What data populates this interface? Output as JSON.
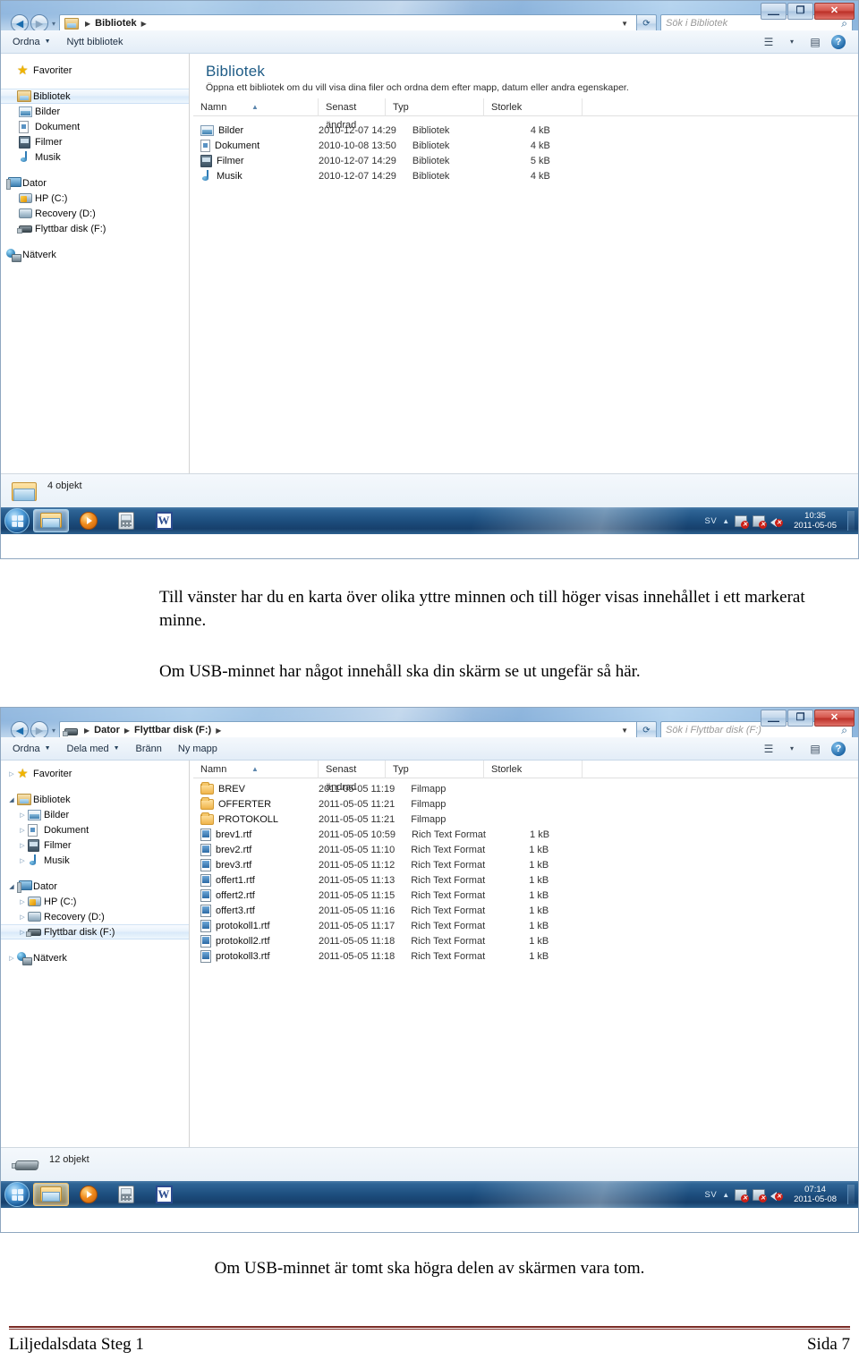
{
  "window1": {
    "titlebar": {
      "minimize_label": "—",
      "maximize_label": "❐",
      "close_label": "✕"
    },
    "address": {
      "crumb": "Bibliotek",
      "separator": "▶",
      "dropdown": "▼",
      "refresh": "⟳",
      "folder_icon": "library-folder-icon"
    },
    "search": {
      "placeholder": "Sök i Bibliotek",
      "icon": "search-icon"
    },
    "commandbar": {
      "items": [
        {
          "label": "Ordna",
          "has_caret": true
        },
        {
          "label": "Nytt bibliotek",
          "has_caret": false
        }
      ],
      "view_icon": "view-list-icon",
      "view_caret": "▾",
      "preview_icon": "preview-pane-icon",
      "help_icon": "help-icon",
      "help_label": "?"
    },
    "navpane": {
      "groups": [
        {
          "items": [
            {
              "label": "Favoriter",
              "icon": "star-icon",
              "indent": 0,
              "arrow": "",
              "selected": false
            }
          ]
        },
        {
          "items": [
            {
              "label": "Bibliotek",
              "icon": "library-folder-icon",
              "indent": 0,
              "arrow": "",
              "selected": true
            },
            {
              "label": "Bilder",
              "icon": "pictures-icon",
              "indent": 1,
              "arrow": "",
              "selected": false
            },
            {
              "label": "Dokument",
              "icon": "documents-icon",
              "indent": 1,
              "arrow": "",
              "selected": false
            },
            {
              "label": "Filmer",
              "icon": "videos-icon",
              "indent": 1,
              "arrow": "",
              "selected": false
            },
            {
              "label": "Musik",
              "icon": "music-icon",
              "indent": 1,
              "arrow": "",
              "selected": false
            }
          ]
        },
        {
          "items": [
            {
              "label": "Dator",
              "icon": "computer-icon",
              "indent": 0,
              "arrow": "",
              "selected": false
            },
            {
              "label": "HP (C:)",
              "icon": "system-drive-icon",
              "indent": 1,
              "arrow": "",
              "selected": false
            },
            {
              "label": "Recovery (D:)",
              "icon": "drive-icon",
              "indent": 1,
              "arrow": "",
              "selected": false
            },
            {
              "label": "Flyttbar disk (F:)",
              "icon": "usb-drive-icon",
              "indent": 1,
              "arrow": "",
              "selected": false
            }
          ]
        },
        {
          "items": [
            {
              "label": "Nätverk",
              "icon": "network-icon",
              "indent": 0,
              "arrow": "",
              "selected": false
            }
          ]
        }
      ]
    },
    "content": {
      "heading": "Bibliotek",
      "subheading": "Öppna ett bibliotek om du vill visa dina filer och ordna dem efter mapp, datum eller andra egenskaper.",
      "columns": [
        "Namn",
        "Senast ändrad",
        "Typ",
        "Storlek"
      ],
      "sort_indicator": "▲",
      "rows": [
        {
          "name": "Bilder",
          "icon": "pictures-icon",
          "modified": "2010-12-07 14:29",
          "type": "Bibliotek",
          "size": "4 kB"
        },
        {
          "name": "Dokument",
          "icon": "documents-icon",
          "modified": "2010-10-08 13:50",
          "type": "Bibliotek",
          "size": "4 kB"
        },
        {
          "name": "Filmer",
          "icon": "videos-icon",
          "modified": "2010-12-07 14:29",
          "type": "Bibliotek",
          "size": "5 kB"
        },
        {
          "name": "Musik",
          "icon": "music-icon",
          "modified": "2010-12-07 14:29",
          "type": "Bibliotek",
          "size": "4 kB"
        }
      ]
    },
    "details": {
      "icon": "folder-icon",
      "text": "4 objekt"
    },
    "taskbar": {
      "start_icon": "windows-start-orb",
      "buttons": [
        {
          "icon": "explorer-icon",
          "state": "active"
        },
        {
          "icon": "media-player-icon",
          "state": "normal"
        },
        {
          "icon": "calculator-icon",
          "state": "normal"
        },
        {
          "icon": "word-icon",
          "state": "normal"
        }
      ],
      "language": "SV",
      "tray_expand": "▲",
      "tray_icons": [
        "network-error-icon",
        "action-center-icon",
        "volume-muted-icon"
      ],
      "time": "10:35",
      "date": "2011-05-05"
    }
  },
  "text1": {
    "paragraph1": "Till vänster har du en karta över olika yttre minnen och till höger visas innehållet i ett markerat minne.",
    "paragraph2": "Om USB-minnet har något innehåll ska din skärm se ut ungefär så här."
  },
  "window2": {
    "titlebar": {
      "minimize_label": "—",
      "maximize_label": "❐",
      "close_label": "✕"
    },
    "address": {
      "crumb1": "Dator",
      "crumb2": "Flyttbar disk (F:)",
      "separator": "▶",
      "dropdown": "▼",
      "refresh": "⟳",
      "folder_icon": "usb-drive-icon"
    },
    "search": {
      "placeholder": "Sök i Flyttbar disk (F:)",
      "icon": "search-icon"
    },
    "commandbar": {
      "items": [
        {
          "label": "Ordna",
          "has_caret": true
        },
        {
          "label": "Dela med",
          "has_caret": true
        },
        {
          "label": "Bränn",
          "has_caret": false
        },
        {
          "label": "Ny mapp",
          "has_caret": false
        }
      ],
      "view_icon": "view-list-icon",
      "view_caret": "▾",
      "preview_icon": "preview-pane-icon",
      "help_icon": "help-icon",
      "help_label": "?"
    },
    "navpane": {
      "groups": [
        {
          "items": [
            {
              "label": "Favoriter",
              "icon": "star-icon",
              "indent": 0,
              "arrow": "closed",
              "selected": false
            }
          ]
        },
        {
          "items": [
            {
              "label": "Bibliotek",
              "icon": "library-folder-icon",
              "indent": 0,
              "arrow": "open",
              "selected": false
            },
            {
              "label": "Bilder",
              "icon": "pictures-icon",
              "indent": 1,
              "arrow": "closed",
              "selected": false
            },
            {
              "label": "Dokument",
              "icon": "documents-icon",
              "indent": 1,
              "arrow": "closed",
              "selected": false
            },
            {
              "label": "Filmer",
              "icon": "videos-icon",
              "indent": 1,
              "arrow": "closed",
              "selected": false
            },
            {
              "label": "Musik",
              "icon": "music-icon",
              "indent": 1,
              "arrow": "closed",
              "selected": false
            }
          ]
        },
        {
          "items": [
            {
              "label": "Dator",
              "icon": "computer-icon",
              "indent": 0,
              "arrow": "open",
              "selected": false
            },
            {
              "label": "HP (C:)",
              "icon": "system-drive-icon",
              "indent": 1,
              "arrow": "closed",
              "selected": false
            },
            {
              "label": "Recovery (D:)",
              "icon": "drive-icon",
              "indent": 1,
              "arrow": "closed",
              "selected": false
            },
            {
              "label": "Flyttbar disk (F:)",
              "icon": "usb-drive-icon",
              "indent": 1,
              "arrow": "closed",
              "selected": true
            }
          ]
        },
        {
          "items": [
            {
              "label": "Nätverk",
              "icon": "network-icon",
              "indent": 0,
              "arrow": "closed",
              "selected": false
            }
          ]
        }
      ]
    },
    "content": {
      "columns": [
        "Namn",
        "Senast ändrad",
        "Typ",
        "Storlek"
      ],
      "sort_indicator": "▲",
      "rows": [
        {
          "name": "BREV",
          "icon": "folder-icon",
          "modified": "2011-05-05 11:19",
          "type": "Filmapp",
          "size": ""
        },
        {
          "name": "OFFERTER",
          "icon": "folder-icon",
          "modified": "2011-05-05 11:21",
          "type": "Filmapp",
          "size": ""
        },
        {
          "name": "PROTOKOLL",
          "icon": "folder-icon",
          "modified": "2011-05-05 11:21",
          "type": "Filmapp",
          "size": ""
        },
        {
          "name": "brev1.rtf",
          "icon": "rtf-file-icon",
          "modified": "2011-05-05 10:59",
          "type": "Rich Text Format",
          "size": "1 kB"
        },
        {
          "name": "brev2.rtf",
          "icon": "rtf-file-icon",
          "modified": "2011-05-05 11:10",
          "type": "Rich Text Format",
          "size": "1 kB"
        },
        {
          "name": "brev3.rtf",
          "icon": "rtf-file-icon",
          "modified": "2011-05-05 11:12",
          "type": "Rich Text Format",
          "size": "1 kB"
        },
        {
          "name": "offert1.rtf",
          "icon": "rtf-file-icon",
          "modified": "2011-05-05 11:13",
          "type": "Rich Text Format",
          "size": "1 kB"
        },
        {
          "name": "offert2.rtf",
          "icon": "rtf-file-icon",
          "modified": "2011-05-05 11:15",
          "type": "Rich Text Format",
          "size": "1 kB"
        },
        {
          "name": "offert3.rtf",
          "icon": "rtf-file-icon",
          "modified": "2011-05-05 11:16",
          "type": "Rich Text Format",
          "size": "1 kB"
        },
        {
          "name": "protokoll1.rtf",
          "icon": "rtf-file-icon",
          "modified": "2011-05-05 11:17",
          "type": "Rich Text Format",
          "size": "1 kB"
        },
        {
          "name": "protokoll2.rtf",
          "icon": "rtf-file-icon",
          "modified": "2011-05-05 11:18",
          "type": "Rich Text Format",
          "size": "1 kB"
        },
        {
          "name": "protokoll3.rtf",
          "icon": "rtf-file-icon",
          "modified": "2011-05-05 11:18",
          "type": "Rich Text Format",
          "size": "1 kB"
        }
      ]
    },
    "details": {
      "icon": "usb-drive-icon",
      "text": "12 objekt"
    },
    "taskbar": {
      "start_icon": "windows-start-orb",
      "buttons": [
        {
          "icon": "explorer-icon",
          "state": "active-orange"
        },
        {
          "icon": "media-player-icon",
          "state": "normal"
        },
        {
          "icon": "calculator-icon",
          "state": "normal"
        },
        {
          "icon": "word-icon",
          "state": "normal"
        }
      ],
      "language": "SV",
      "tray_expand": "▲",
      "tray_icons": [
        "network-error-icon",
        "action-center-icon",
        "volume-muted-icon"
      ],
      "time": "07:14",
      "date": "2011-05-08"
    }
  },
  "text2": {
    "paragraph": "Om USB-minnet är tomt ska högra delen av skärmen vara tom."
  },
  "footer": {
    "left": "Liljedalsdata Steg 1",
    "right": "Sida 7"
  },
  "colors": {
    "title_accent": "#1f5c86",
    "footer_rule": "#7b2a24",
    "taskbar": "#1d4e7e",
    "close_button": "#bb2e26"
  }
}
